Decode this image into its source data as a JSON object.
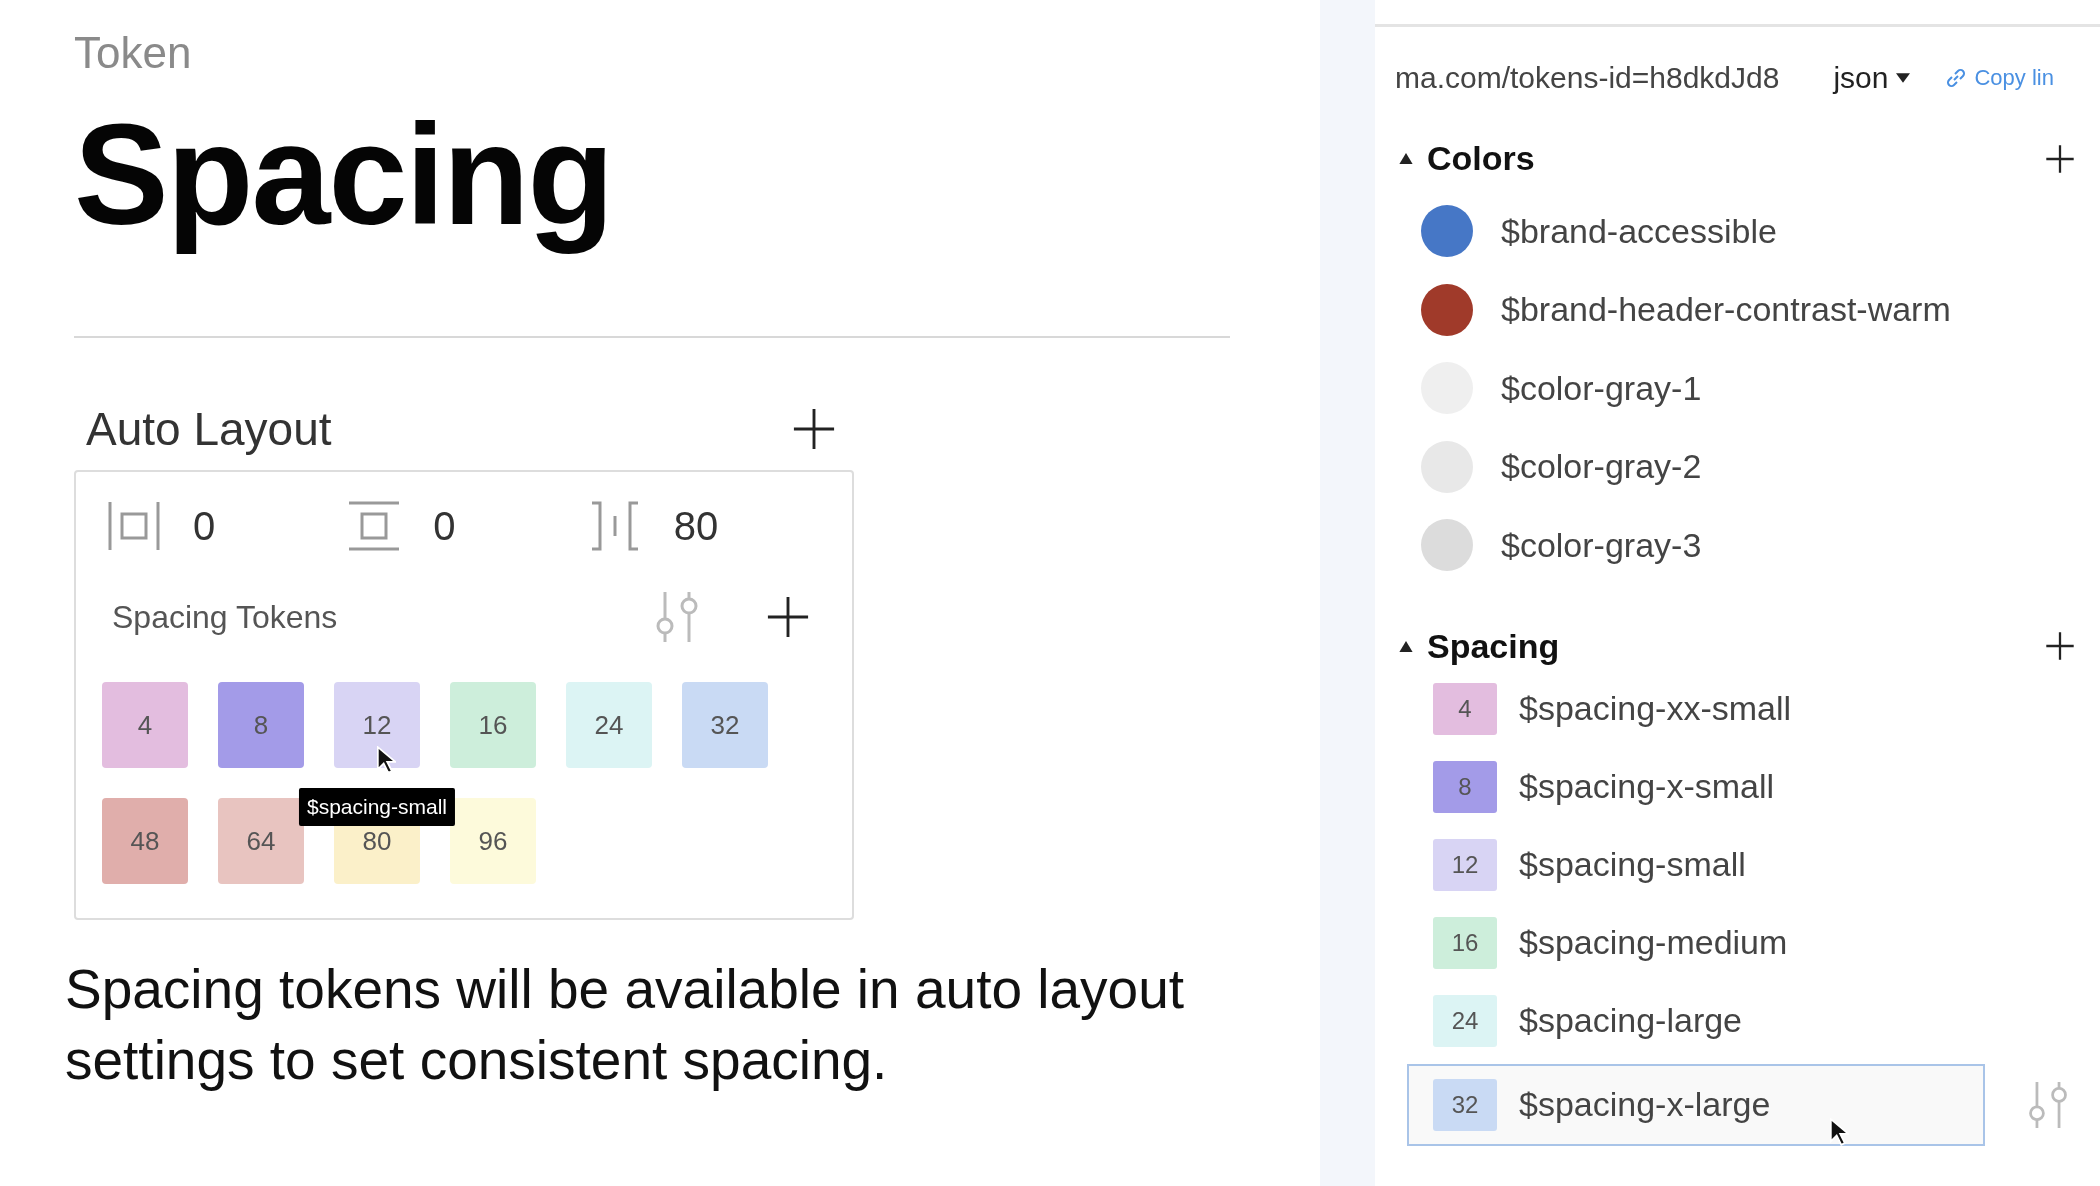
{
  "header": {
    "eyebrow": "Token",
    "title": "Spacing"
  },
  "auto_layout": {
    "title": "Auto Layout",
    "fields": [
      {
        "kind": "horizontal",
        "value": "0"
      },
      {
        "kind": "vertical",
        "value": "0"
      },
      {
        "kind": "gap",
        "value": "80"
      }
    ],
    "tokens_label": "Spacing Tokens",
    "swatches": [
      {
        "label": "4",
        "color": "#e3bddf"
      },
      {
        "label": "8",
        "color": "#a39be8"
      },
      {
        "label": "12",
        "color": "#d8d4f4",
        "tooltip": "$spacing-small"
      },
      {
        "label": "16",
        "color": "#cdeedb"
      },
      {
        "label": "24",
        "color": "#dcf4f4"
      },
      {
        "label": "32",
        "color": "#c9daf4"
      },
      {
        "label": "48",
        "color": "#e0aeab"
      },
      {
        "label": "64",
        "color": "#e8c4c0"
      },
      {
        "label": "80",
        "color": "#fbf0c9"
      },
      {
        "label": "96",
        "color": "#fdfadb"
      }
    ]
  },
  "description": "Spacing tokens will be available in auto layout settings to set consistent spacing.",
  "panel": {
    "url": "ma.com/tokens-id=h8dkdJd8",
    "format": "json",
    "copy_link": "Copy lin",
    "groups": [
      {
        "title": "Colors",
        "kind": "colors",
        "expanded": true,
        "items": [
          {
            "name": "$brand-accessible",
            "color": "#4677c6"
          },
          {
            "name": "$brand-header-contrast-warm",
            "color": "#a03a2a"
          },
          {
            "name": "$color-gray-1",
            "color": "#efefef"
          },
          {
            "name": "$color-gray-2",
            "color": "#e8e8e8"
          },
          {
            "name": "$color-gray-3",
            "color": "#dcdcdc"
          }
        ]
      },
      {
        "title": "Spacing",
        "kind": "spacing",
        "expanded": true,
        "items": [
          {
            "value": "4",
            "name": "$spacing-xx-small",
            "color": "#e3bddf",
            "selected": false
          },
          {
            "value": "8",
            "name": "$spacing-x-small",
            "color": "#a39be8",
            "selected": false
          },
          {
            "value": "12",
            "name": "$spacing-small",
            "color": "#d8d4f4",
            "selected": false
          },
          {
            "value": "16",
            "name": "$spacing-medium",
            "color": "#cdeedb",
            "selected": false
          },
          {
            "value": "24",
            "name": "$spacing-large",
            "color": "#dcf4f4",
            "selected": false
          },
          {
            "value": "32",
            "name": "$spacing-x-large",
            "color": "#c9daf4",
            "selected": true
          }
        ]
      }
    ]
  }
}
